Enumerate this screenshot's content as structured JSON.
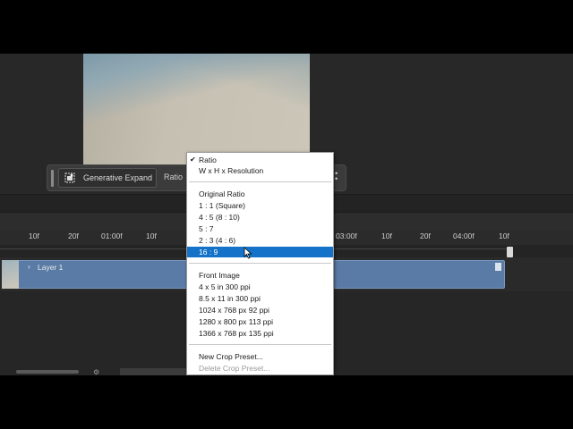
{
  "taskbar": {
    "generative_expand_label": "Generative Expand",
    "ratio_label": "Ratio"
  },
  "timeline": {
    "ruler_ticks": [
      "10f",
      "20f",
      "01:00f",
      "10f",
      "03:00f",
      "10f",
      "20f",
      "04:00f",
      "10f"
    ],
    "layer_name": "Layer 1"
  },
  "menu": {
    "items": [
      {
        "label": "Ratio",
        "checked": true
      },
      {
        "label": "W x H x Resolution"
      },
      {
        "label": "Original Ratio"
      },
      {
        "label": "1 : 1 (Square)"
      },
      {
        "label": "4 : 5 (8 : 10)"
      },
      {
        "label": "5 : 7"
      },
      {
        "label": "2 : 3 (4 : 6)"
      },
      {
        "label": "16 : 9",
        "selected": true
      },
      {
        "label": "Front Image"
      },
      {
        "label": "4 x 5 in 300 ppi"
      },
      {
        "label": "8.5 x 11 in 300 ppi"
      },
      {
        "label": "1024 x 768 px 92 ppi"
      },
      {
        "label": "1280 x 800 px 113 ppi"
      },
      {
        "label": "1366 x 768 px 135 ppi"
      },
      {
        "label": "New Crop Preset..."
      },
      {
        "label": "Delete Crop Preset...",
        "disabled": true
      }
    ]
  },
  "colors": {
    "selection": "#1473c8",
    "layer_track": "#5a7ba5",
    "panel_bg": "#282828"
  },
  "icons": [
    "generative-expand-icon",
    "chevron-right-icon",
    "checkmark-icon",
    "more-options-icon",
    "cursor-icon"
  ]
}
